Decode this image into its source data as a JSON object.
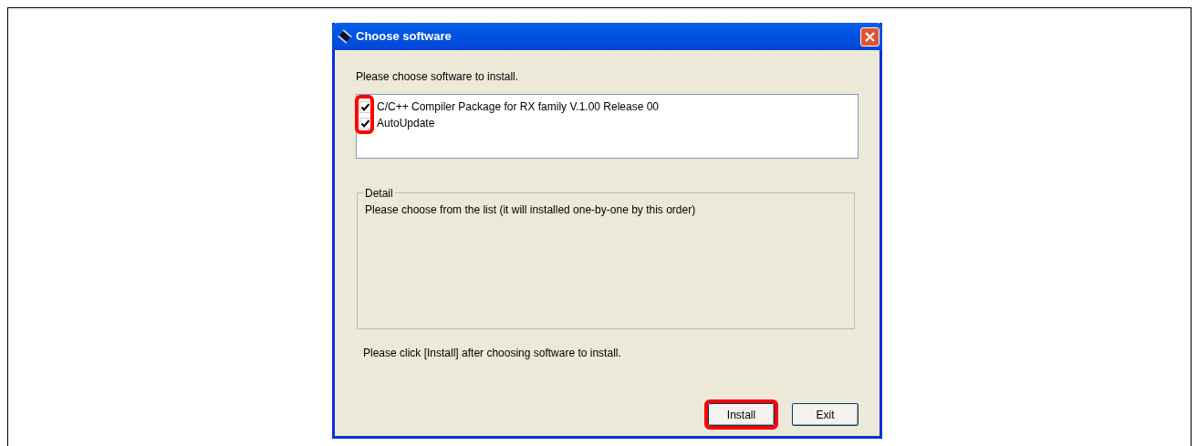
{
  "window": {
    "title": "Choose software"
  },
  "prompt": "Please choose software to install.",
  "software": [
    {
      "label": "C/C++ Compiler Package for RX family V.1.00 Release 00",
      "checked": true
    },
    {
      "label": "AutoUpdate",
      "checked": true
    }
  ],
  "detail": {
    "legend": "Detail",
    "text": "Please choose from the list (it will installed one-by-one by this order)"
  },
  "hint": "Please click [Install] after choosing software to install.",
  "buttons": [
    {
      "label": "Install",
      "highlighted": true
    },
    {
      "label": "Exit",
      "highlighted": false
    }
  ]
}
